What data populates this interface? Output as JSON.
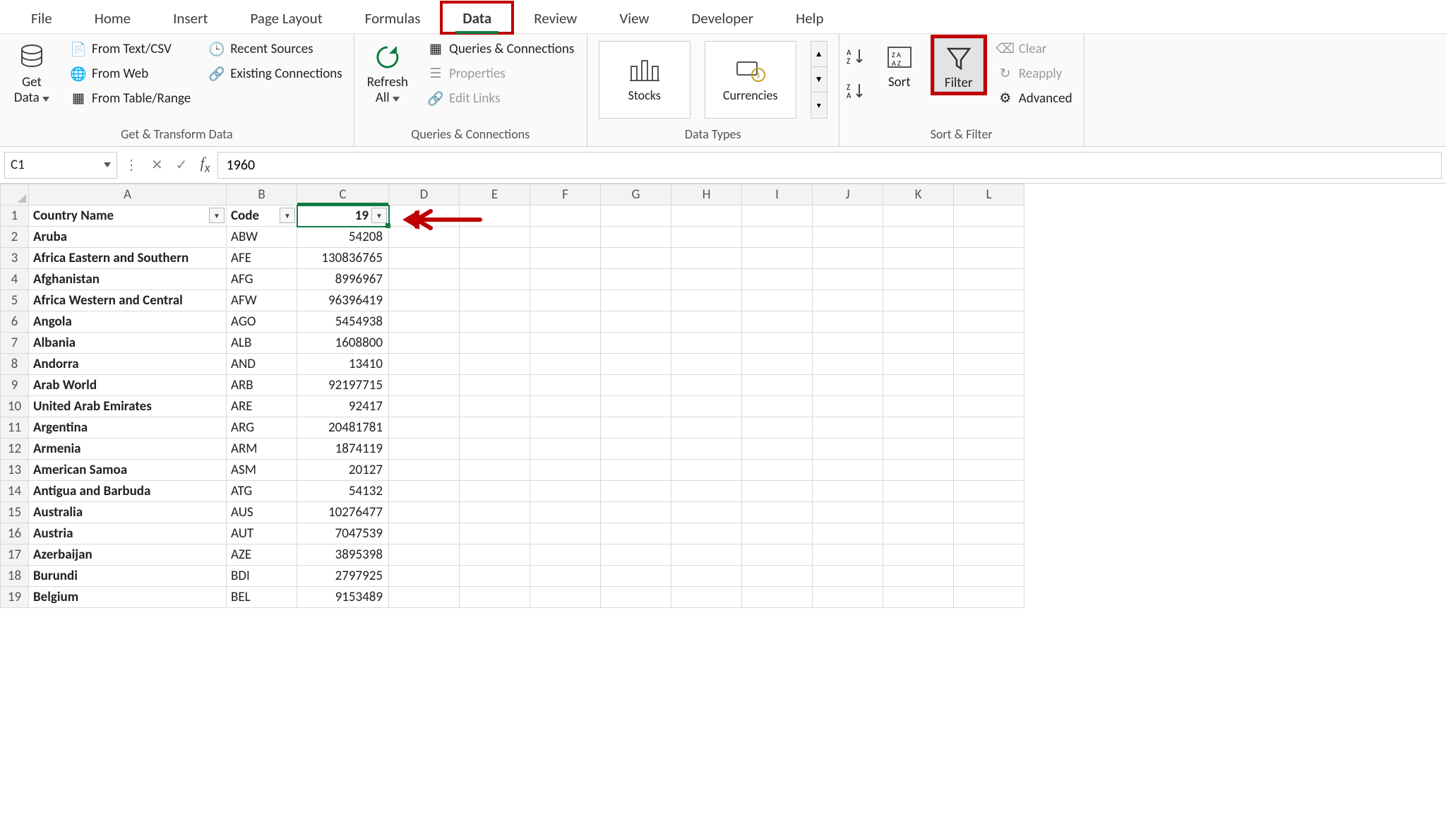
{
  "menu": {
    "tabs": [
      "File",
      "Home",
      "Insert",
      "Page Layout",
      "Formulas",
      "Data",
      "Review",
      "View",
      "Developer",
      "Help"
    ],
    "active_index": 5
  },
  "ribbon": {
    "get_transform": {
      "big": "Get\nData",
      "items": [
        "From Text/CSV",
        "From Web",
        "From Table/Range",
        "Recent Sources",
        "Existing Connections"
      ],
      "label": "Get & Transform Data"
    },
    "queries": {
      "big": "Refresh\nAll",
      "items": [
        "Queries & Connections",
        "Properties",
        "Edit Links"
      ],
      "label": "Queries & Connections"
    },
    "data_types": {
      "items": [
        "Stocks",
        "Currencies"
      ],
      "label": "Data Types"
    },
    "sort_filter": {
      "sort": "Sort",
      "filter": "Filter",
      "items": [
        "Clear",
        "Reapply",
        "Advanced"
      ],
      "label": "Sort & Filter"
    }
  },
  "formula_bar": {
    "name_box": "C1",
    "formula": "1960"
  },
  "sheet": {
    "columns": [
      "A",
      "B",
      "C",
      "D",
      "E",
      "F",
      "G",
      "H",
      "I",
      "J",
      "K",
      "L"
    ],
    "header_row": {
      "a": "Country Name",
      "b": "Code",
      "c": "19"
    },
    "rows": [
      {
        "n": 2,
        "a": "Aruba",
        "b": "ABW",
        "c": "54208"
      },
      {
        "n": 3,
        "a": "Africa Eastern and Southern",
        "b": "AFE",
        "c": "130836765"
      },
      {
        "n": 4,
        "a": "Afghanistan",
        "b": "AFG",
        "c": "8996967"
      },
      {
        "n": 5,
        "a": "Africa Western and Central",
        "b": "AFW",
        "c": "96396419"
      },
      {
        "n": 6,
        "a": "Angola",
        "b": "AGO",
        "c": "5454938"
      },
      {
        "n": 7,
        "a": "Albania",
        "b": "ALB",
        "c": "1608800"
      },
      {
        "n": 8,
        "a": "Andorra",
        "b": "AND",
        "c": "13410"
      },
      {
        "n": 9,
        "a": "Arab World",
        "b": "ARB",
        "c": "92197715"
      },
      {
        "n": 10,
        "a": "United Arab Emirates",
        "b": "ARE",
        "c": "92417"
      },
      {
        "n": 11,
        "a": "Argentina",
        "b": "ARG",
        "c": "20481781"
      },
      {
        "n": 12,
        "a": "Armenia",
        "b": "ARM",
        "c": "1874119"
      },
      {
        "n": 13,
        "a": "American Samoa",
        "b": "ASM",
        "c": "20127"
      },
      {
        "n": 14,
        "a": "Antigua and Barbuda",
        "b": "ATG",
        "c": "54132"
      },
      {
        "n": 15,
        "a": "Australia",
        "b": "AUS",
        "c": "10276477"
      },
      {
        "n": 16,
        "a": "Austria",
        "b": "AUT",
        "c": "7047539"
      },
      {
        "n": 17,
        "a": "Azerbaijan",
        "b": "AZE",
        "c": "3895398"
      },
      {
        "n": 18,
        "a": "Burundi",
        "b": "BDI",
        "c": "2797925"
      },
      {
        "n": 19,
        "a": "Belgium",
        "b": "BEL",
        "c": "9153489"
      }
    ]
  }
}
